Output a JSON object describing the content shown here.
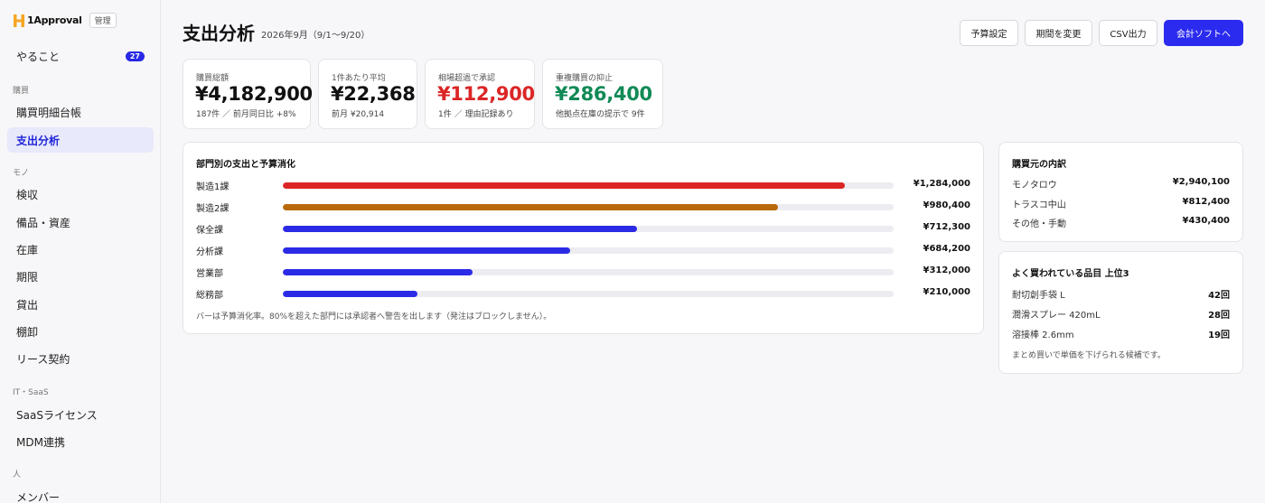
{
  "brand": {
    "name": "1Approval",
    "badge": "管理",
    "logo_icon": "h-logo-icon",
    "logo_color": "#f5a623"
  },
  "sidebar": {
    "todo": {
      "label": "やること",
      "count": "27"
    },
    "sections": [
      {
        "title": "購買",
        "items": [
          {
            "label": "購買明細台帳"
          },
          {
            "label": "支出分析",
            "active": true
          }
        ]
      },
      {
        "title": "モノ",
        "items": [
          {
            "label": "検収"
          },
          {
            "label": "備品・資産"
          },
          {
            "label": "在庫"
          },
          {
            "label": "期限"
          },
          {
            "label": "貸出"
          },
          {
            "label": "棚卸"
          },
          {
            "label": "リース契約"
          }
        ]
      },
      {
        "title": "IT・SaaS",
        "items": [
          {
            "label": "SaaSライセンス"
          },
          {
            "label": "MDM連携"
          }
        ]
      },
      {
        "title": "人",
        "items": [
          {
            "label": "メンバー"
          }
        ]
      }
    ]
  },
  "header": {
    "title": "支出分析",
    "period": "2026年9月（9/1〜9/20）",
    "buttons": {
      "budget": "予算設定",
      "period": "期間を変更",
      "csv": "CSV出力",
      "accounting": "会計ソフトへ"
    }
  },
  "kpis": [
    {
      "label": "購買総額",
      "value": "¥4,182,900",
      "note": "187件 ／ 前月同日比 +8%"
    },
    {
      "label": "1件あたり平均",
      "value": "¥22,368",
      "note": "前月 ¥20,914"
    },
    {
      "label": "相場超過で承認",
      "value": "¥112,900",
      "note": "1件 ／ 理由記録あり",
      "color": "#dc2626"
    },
    {
      "label": "重複購買の抑止",
      "value": "¥286,400",
      "note": "他拠点在庫の提示で 9件",
      "color": "#118a56"
    }
  ],
  "departments": {
    "title": "部門別の支出と予算消化",
    "rows": [
      {
        "name": "製造1課",
        "amount": "¥1,284,000",
        "usage": 0.92,
        "color": "#dc2626"
      },
      {
        "name": "製造2課",
        "amount": "¥980,400",
        "usage": 0.81,
        "color": "#b8690a"
      },
      {
        "name": "保全課",
        "amount": "¥712,300",
        "usage": 0.58,
        "color": "#2b2be6"
      },
      {
        "name": "分析課",
        "amount": "¥684,200",
        "usage": 0.47,
        "color": "#2b2be6"
      },
      {
        "name": "営業部",
        "amount": "¥312,000",
        "usage": 0.31,
        "color": "#2b2be6"
      },
      {
        "name": "総務部",
        "amount": "¥210,000",
        "usage": 0.22,
        "color": "#2b2be6"
      }
    ],
    "note": "バーは予算消化率。80%を超えた部門には承認者へ警告を出します（発注はブロックしません）。"
  },
  "vendors": {
    "title": "購買元の内訳",
    "rows": [
      {
        "name": "モノタロウ",
        "value": "¥2,940,100"
      },
      {
        "name": "トラスコ中山",
        "value": "¥812,400"
      },
      {
        "name": "その他・手動",
        "value": "¥430,400"
      }
    ]
  },
  "top_items": {
    "title": "よく買われている品目 上位3",
    "rows": [
      {
        "name": "耐切創手袋 L",
        "value": "42回"
      },
      {
        "name": "潤滑スプレー 420mL",
        "value": "28回"
      },
      {
        "name": "溶接棒 2.6mm",
        "value": "19回"
      }
    ],
    "note": "まとめ買いで単価を下げられる候補です。"
  }
}
